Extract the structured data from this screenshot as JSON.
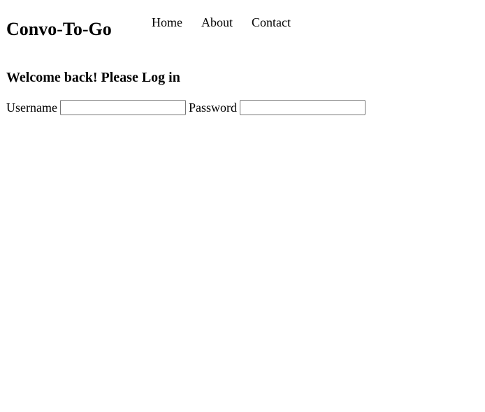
{
  "header": {
    "brand": "Convo-To-Go",
    "nav": [
      {
        "label": "Home"
      },
      {
        "label": "About"
      },
      {
        "label": "Contact"
      }
    ]
  },
  "main": {
    "heading": "Welcome back! Please Log in",
    "form": {
      "username_label": "Username",
      "username_value": "",
      "password_label": "Password",
      "password_value": ""
    }
  }
}
